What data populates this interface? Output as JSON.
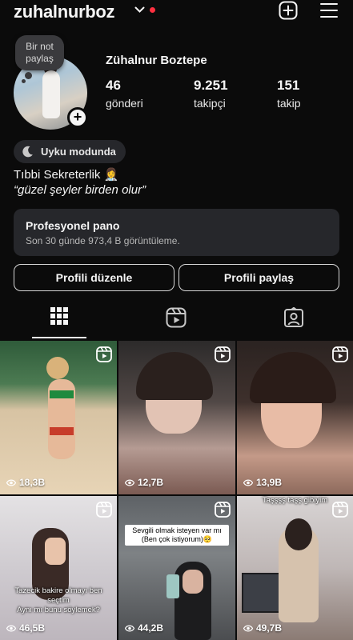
{
  "header": {
    "username": "zuhalnurboz",
    "icons": [
      "chevron-down-icon",
      "notification-dot",
      "new-post-icon",
      "menu-icon"
    ]
  },
  "profile": {
    "note": "Bir not paylaş",
    "full_name": "Zühalnur Boztepe",
    "stats": [
      {
        "value": "46",
        "label": "gönderi"
      },
      {
        "value": "9.251",
        "label": "takipçi"
      },
      {
        "value": "151",
        "label": "takip"
      }
    ],
    "status": "Uyku modunda",
    "bio_line1": "Tıbbi Sekreterlik 👩‍⚕️",
    "bio_line2": "“güzel şeyler birden olur”"
  },
  "pro_dashboard": {
    "title": "Profesyonel pano",
    "subtitle": "Son 30 günde 973,4 B görüntüleme."
  },
  "actions": {
    "edit_label": "Profili düzenle",
    "share_label": "Profili paylaş"
  },
  "tabs": [
    {
      "name": "grid",
      "icon": "grid-icon",
      "active": true
    },
    {
      "name": "reels",
      "icon": "reels-icon",
      "active": false
    },
    {
      "name": "tagged",
      "icon": "tagged-icon",
      "active": false
    }
  ],
  "posts": [
    {
      "views": "18,3B"
    },
    {
      "views": "12,7B"
    },
    {
      "views": "13,9B"
    },
    {
      "views": "46,5B",
      "caption": "Tazecik bakire olmayı ben seçtim\nAynı mı bunu söylemek?"
    },
    {
      "views": "44,2B",
      "caption": "Sevgili olmak isteyen var mı\n(Ben çok istiyorum)🥺"
    },
    {
      "views": "49,7B",
      "caption": "Taşşşş taşş gibiyim"
    }
  ],
  "colors": {
    "background": "#0b0b0b",
    "panel": "#26272b",
    "notification": "#ff3040",
    "text": "#f5f5f5"
  }
}
